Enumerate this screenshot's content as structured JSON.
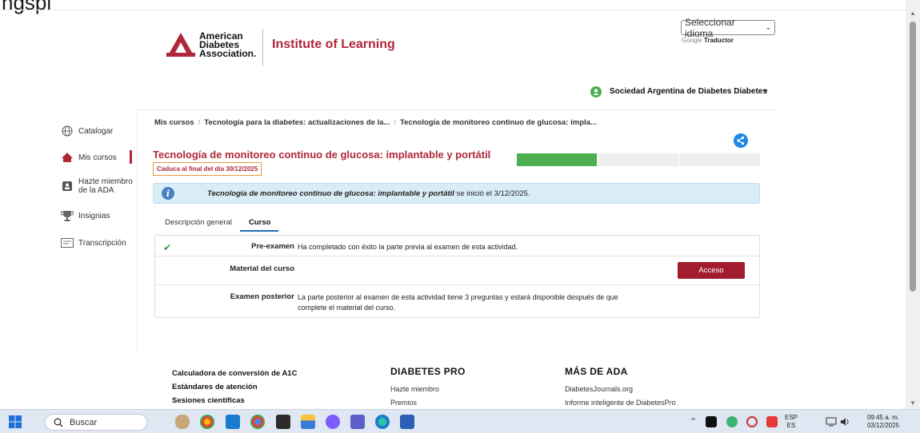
{
  "top_partial_text": "ngspi",
  "logo": {
    "line1": "American",
    "line2": "Diabetes",
    "line3": "Association.",
    "institute": "Institute of Learning"
  },
  "language": {
    "select_value": "Seleccionar idioma",
    "powered_prefix": "Google",
    "powered_name": "Traductor"
  },
  "organization": {
    "name": "Sociedad Argentina de Diabetes Diabetes"
  },
  "sidebar": {
    "items": [
      {
        "label": "Catalogar",
        "icon": "globe-icon"
      },
      {
        "label": "Mis cursos",
        "icon": "home-icon"
      },
      {
        "label": "Hazte miembro",
        "label2": "de la ADA",
        "icon": "member-card-icon"
      },
      {
        "label": "Insignias",
        "icon": "trophy-icon"
      },
      {
        "label": "Transcripción",
        "icon": "transcript-icon"
      }
    ]
  },
  "breadcrumb": {
    "items": [
      "Mis cursos",
      "Tecnología para la diabetes: actualizaciones de la...",
      "Tecnología de monitoreo continuo de glucosa: impla..."
    ]
  },
  "course": {
    "title": "Tecnología de monitoreo continuo de glucosa: implantable y portátil",
    "expiry": "Caduca al final del día 30/12/2025",
    "progress_fraction": 0.33,
    "info_title": "Tecnología de monitoreo continuo de glucosa: implantable y portátil",
    "info_suffix": " se inició el 3/12/2025."
  },
  "tabs": [
    {
      "label": "Descripción general",
      "active": false
    },
    {
      "label": "Curso",
      "active": true
    }
  ],
  "course_rows": [
    {
      "label": "Pre-examen",
      "text": "Ha completado con éxito la parte previa al examen de esta actividad.",
      "completed": true
    },
    {
      "label": "Material del curso",
      "button": "Acceso"
    },
    {
      "label": "Examen posterior",
      "text1": "La parte posterior al examen de esta actividad tiene 3 preguntas y estará disponible después de que",
      "text2": "complete el material del curso."
    }
  ],
  "footer": {
    "links": [
      "Calculadora de conversión de A1C",
      "Estándares de atención",
      "Sesiones científicas"
    ],
    "col2": {
      "heading": "DIABETES PRO",
      "items": [
        "Hazte miembro",
        "Premios"
      ]
    },
    "col3": {
      "heading": "MÁS DE ADA",
      "items": [
        "DiabetesJournals.org",
        "Informe inteligente de DiabetesPro"
      ]
    }
  },
  "taskbar": {
    "search_placeholder": "Buscar",
    "lang_top": "ESP",
    "lang_bottom": "ES",
    "time": "09:45 a. m.",
    "date": "03/12/2025"
  },
  "colors": {
    "brand_red": "#b0273a",
    "progress_green": "#4caf50",
    "info_blue": "#d9edf7",
    "button_red": "#a11d2e"
  }
}
